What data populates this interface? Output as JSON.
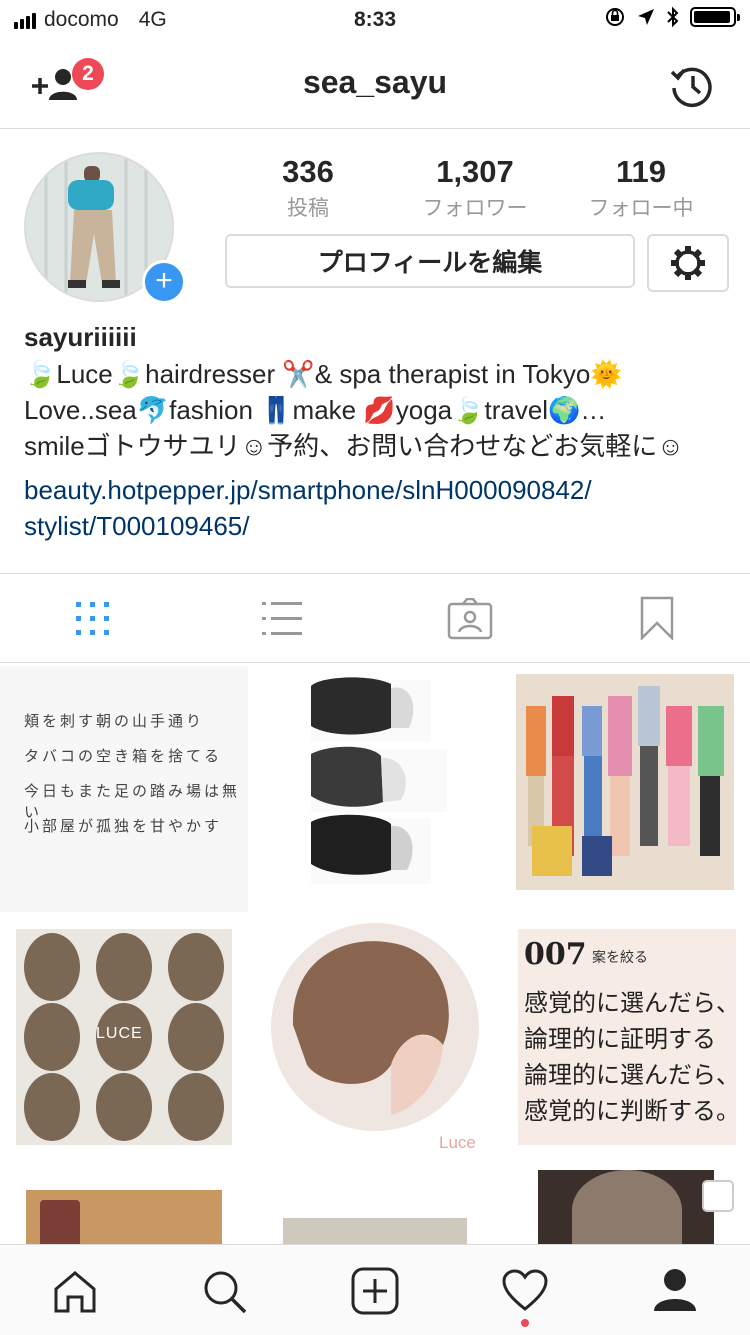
{
  "status_bar": {
    "carrier": "docomo",
    "network": "4G",
    "time": "8:33"
  },
  "header": {
    "title": "sea_sayu",
    "notification_count": "2"
  },
  "profile": {
    "stats": [
      {
        "value": "336",
        "label": "投稿"
      },
      {
        "value": "1,307",
        "label": "フォロワー"
      },
      {
        "value": "119",
        "label": "フォロー中"
      }
    ],
    "edit_button": "プロフィールを編集",
    "name": "sayuriiiiii",
    "bio_lines": [
      "🍃Luce🍃hairdresser ✂️& spa therapist in Tokyo🌞",
      "Love..sea🐬fashion 👖make 💋yoga🍃travel🌍…",
      "smileゴトウサユリ☺予約、お問い合わせなどお気軽に☺"
    ],
    "link_lines": [
      "beauty.hotpepper.jp/smartphone/slnH000090842/",
      "stylist/T000109465/"
    ]
  },
  "tabs": [
    "grid-icon",
    "list-icon",
    "tagged-icon",
    "bookmark-icon"
  ],
  "posts": {
    "tanka_lines": [
      "頬を刺す朝の山手通り",
      "タバコの空き箱を捨てる",
      "今日もまた足の踏み場は無い",
      "小部屋が孤独を甘やかす"
    ],
    "luce_label": "LUCE",
    "portrait_label": "Luce",
    "quote_number": "007",
    "quote_tag": "案を絞る",
    "quote_lines": [
      "感覚的に選んだら、",
      "論理的に証明する",
      "論理的に選んだら、",
      "感覚的に判断する。"
    ]
  },
  "bottom_nav": [
    "home-icon",
    "search-icon",
    "add-post-icon",
    "heart-icon",
    "profile-icon"
  ],
  "colors": {
    "accent": "#3897f0",
    "badge": "#ed4956",
    "link": "#003569"
  }
}
